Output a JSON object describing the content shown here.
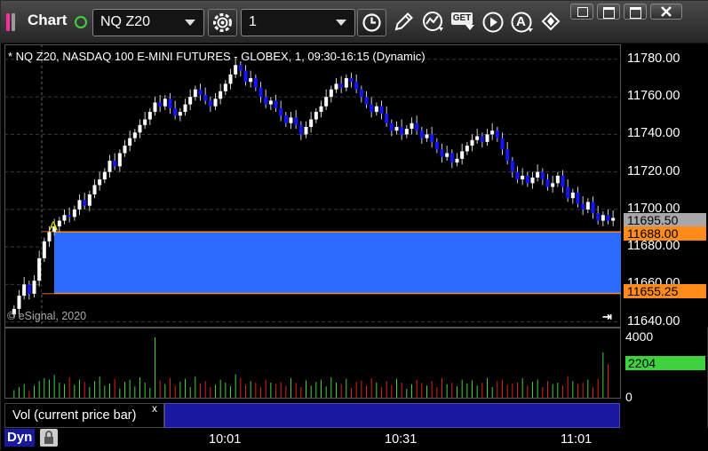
{
  "app": {
    "title": "Chart",
    "brand_colors": {
      "pink": "#ff2f9a",
      "gray": "#9a9a9a"
    },
    "status_color": "#3fd23f"
  },
  "toolbar": {
    "symbol": "NQ Z20",
    "interval": "1",
    "icons": [
      "settings-gear-icon",
      "time-clock-icon",
      "pencil-draw-icon",
      "chart-style-icon",
      "get-data-icon",
      "play-icon",
      "alert-a-icon",
      "cursor-diamond-icon"
    ],
    "get_label": "GET",
    "alert_label": "A"
  },
  "window_controls": [
    "restore-icon",
    "maximize-icon",
    "minimize-icon",
    "close-icon"
  ],
  "chart": {
    "header": "* NQ Z20, NASDAQ 100 E-MINI FUTURES - GLOBEX, 1, 09:30-16:15 (Dynamic)",
    "copyright": "© eSignal, 2020",
    "price_ticks": [
      "11780.00",
      "11760.00",
      "11740.00",
      "11720.00",
      "11700.00",
      "11680.00",
      "11660.00",
      "11640.00"
    ],
    "price_tick_values": [
      11780,
      11760,
      11740,
      11720,
      11700,
      11680,
      11660,
      11640
    ],
    "last_price": "11695.50",
    "box_top_label": "11688.00",
    "box_bottom_label": "11655.25",
    "box_top": 11688.0,
    "box_bottom": 11655.25,
    "last_value": 11695.5,
    "marker_label": "A",
    "colors": {
      "up": "#ffffff",
      "down": "#1414ff",
      "box": "#2b6cff",
      "box_line": "#ff8c1a",
      "last_bg": "#a8a8a8"
    }
  },
  "volume": {
    "ticks": [
      "4000",
      "0"
    ],
    "current": "2204",
    "study_label": "Vol (current price bar)",
    "close_label": "x"
  },
  "time_axis": {
    "ticks": [
      "10:01",
      "10:31",
      "11:01"
    ]
  },
  "bottom": {
    "dyn_label": "Dyn"
  },
  "chart_data": {
    "type": "candlestick",
    "title": "* NQ Z20, NASDAQ 100 E-MINI FUTURES - GLOBEX, 1, 09:30-16:15 (Dynamic)",
    "y_range": [
      11637,
      11788
    ],
    "interval_minutes": 1,
    "x_ticks": [
      "10:01",
      "10:31",
      "11:01"
    ],
    "closes": [
      11647,
      11654,
      11660,
      11655,
      11662,
      11674,
      11683,
      11688,
      11691,
      11694,
      11697,
      11696,
      11700,
      11705,
      11702,
      11708,
      11713,
      11716,
      11720,
      11726,
      11723,
      11730,
      11734,
      11738,
      11741,
      11745,
      11748,
      11752,
      11757,
      11755,
      11759,
      11754,
      11750,
      11752,
      11756,
      11760,
      11764,
      11761,
      11758,
      11755,
      11759,
      11763,
      11767,
      11772,
      11777,
      11774,
      11768,
      11770,
      11765,
      11760,
      11756,
      11758,
      11754,
      11750,
      11746,
      11749,
      11745,
      11740,
      11744,
      11748,
      11752,
      11755,
      11760,
      11764,
      11767,
      11765,
      11770,
      11768,
      11764,
      11760,
      11756,
      11752,
      11755,
      11751,
      11746,
      11742,
      11744,
      11740,
      11743,
      11746,
      11742,
      11738,
      11740,
      11736,
      11732,
      11728,
      11730,
      11725,
      11727,
      11731,
      11734,
      11737,
      11739,
      11736,
      11740,
      11742,
      11738,
      11732,
      11726,
      11720,
      11716,
      11718,
      11714,
      11717,
      11720,
      11716,
      11712,
      11714,
      11718,
      11712,
      11706,
      11709,
      11703,
      11700,
      11704,
      11698,
      11694,
      11697,
      11694,
      11695.5
    ],
    "volume": [
      500,
      700,
      900,
      450,
      800,
      1100,
      1300,
      1200,
      1500,
      1000,
      900,
      1350,
      850,
      1200,
      1050,
      700,
      1100,
      1400,
      800,
      950,
      1250,
      600,
      1050,
      1200,
      750,
      1350,
      1000,
      650,
      4000,
      1150,
      900,
      1300,
      800,
      1050,
      1250,
      700,
      1400,
      950,
      1100,
      700,
      850,
      1200,
      1000,
      750,
      1550,
      1300,
      850,
      1100,
      1000,
      700,
      1200,
      1000,
      900,
      1050,
      800,
      1300,
      1000,
      700,
      1150,
      800,
      1050,
      1200,
      750,
      1350,
      1000,
      900,
      1250,
      650,
      1050,
      1150,
      800,
      1300,
      1000,
      700,
      1100,
      850,
      1250,
      1000,
      600,
      900,
      1200,
      1000,
      800,
      1100,
      700,
      1300,
      900,
      1000,
      750,
      1200,
      950,
      1150,
      800,
      1000,
      1300,
      700,
      1100,
      1200,
      850,
      950,
      1000,
      1300,
      800,
      1050,
      1200,
      700,
      1100,
      900,
      1000,
      800,
      1400,
      1100,
      900,
      1000,
      1200,
      700,
      1250,
      3000,
      2204
    ],
    "annotations": {
      "box_top": 11688.0,
      "box_bottom": 11655.25,
      "last": 11695.5,
      "volume_last": 2204,
      "volume_axis": [
        0,
        4000
      ]
    }
  }
}
